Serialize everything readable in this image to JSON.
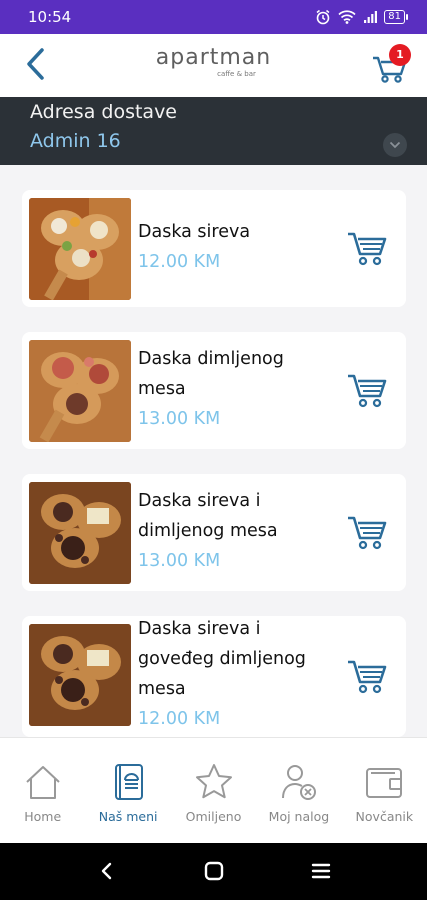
{
  "status_bar": {
    "time": "10:54",
    "battery": "81"
  },
  "header": {
    "brand": "apartman",
    "tagline": "caffe & bar",
    "cart_count": "1"
  },
  "address": {
    "label": "Adresa dostave",
    "value": "Admin 16"
  },
  "products": [
    {
      "name": "Daska sireva",
      "price": "12.00 KM"
    },
    {
      "name": "Daska dimljenog mesa",
      "price": "13.00 KM"
    },
    {
      "name": "Daska sireva i dimljenog mesa",
      "price": "13.00 KM"
    },
    {
      "name": "Daska sireva i goveđeg dimljenog mesa",
      "price": "12.00 KM"
    }
  ],
  "bottom_nav": [
    {
      "label": "Home",
      "icon": "home-icon"
    },
    {
      "label": "Naš meni",
      "icon": "menu-book-icon",
      "active": true
    },
    {
      "label": "Omiljeno",
      "icon": "star-icon"
    },
    {
      "label": "Moj nalog",
      "icon": "user-icon"
    },
    {
      "label": "Novčanik",
      "icon": "wallet-icon"
    }
  ],
  "colors": {
    "status_bar": "#5a2fc0",
    "address_bar": "#2b3137",
    "accent_blue": "#2b6c9a",
    "price_blue": "#7ec4ea",
    "badge_red": "#e41b23"
  }
}
